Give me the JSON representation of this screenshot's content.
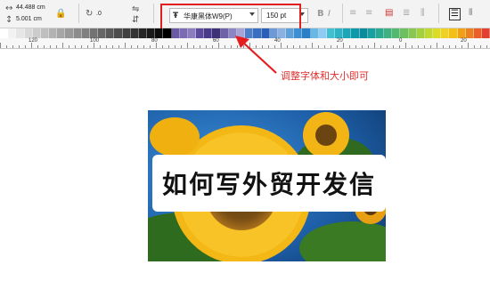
{
  "toolbar": {
    "width_value": "44.488 cm",
    "height_value": "5.001 cm",
    "rotation_value": ".0",
    "font_name": "华康黑体W9(P)",
    "font_size": "150 pt"
  },
  "palette": {
    "colors": [
      "#ffffff",
      "#f2f2f2",
      "#e6e6e6",
      "#d9d9d9",
      "#cccccc",
      "#bfbfbf",
      "#b3b3b3",
      "#a6a6a6",
      "#999999",
      "#8c8c8c",
      "#808080",
      "#737373",
      "#666666",
      "#595959",
      "#4d4d4d",
      "#404040",
      "#333333",
      "#262626",
      "#1a1a1a",
      "#0d0d0d",
      "#000000",
      "#6b5aa6",
      "#7b6bb3",
      "#8a7dc0",
      "#5c4a9a",
      "#4a3b8a",
      "#3c3078",
      "#6e62a8",
      "#8c86c4",
      "#a7a3d4",
      "#4d80c9",
      "#3a6fc0",
      "#2a5fb5",
      "#6b9ad6",
      "#8ab1e0",
      "#5fa0d8",
      "#3d8fd1",
      "#2b7fc6",
      "#6ab7e6",
      "#8fcaf0",
      "#40c0d0",
      "#2fb3c4",
      "#1aa6b8",
      "#0e98aa",
      "#0a8a9a",
      "#16a0a0",
      "#2aa890",
      "#3fb080",
      "#55b870",
      "#6cc060",
      "#88c850",
      "#a4d040",
      "#c0d830",
      "#dcdc28",
      "#f0d020",
      "#f4c018",
      "#f0a018",
      "#ec8020",
      "#e86028",
      "#e44030"
    ]
  },
  "ruler": {
    "labels": [
      "120",
      "100",
      "80",
      "60",
      "40",
      "20",
      "0",
      "20"
    ]
  },
  "annotation": {
    "text": "调整字体和大小即可"
  },
  "canvas": {
    "banner_text": "如何写外贸开发信"
  }
}
